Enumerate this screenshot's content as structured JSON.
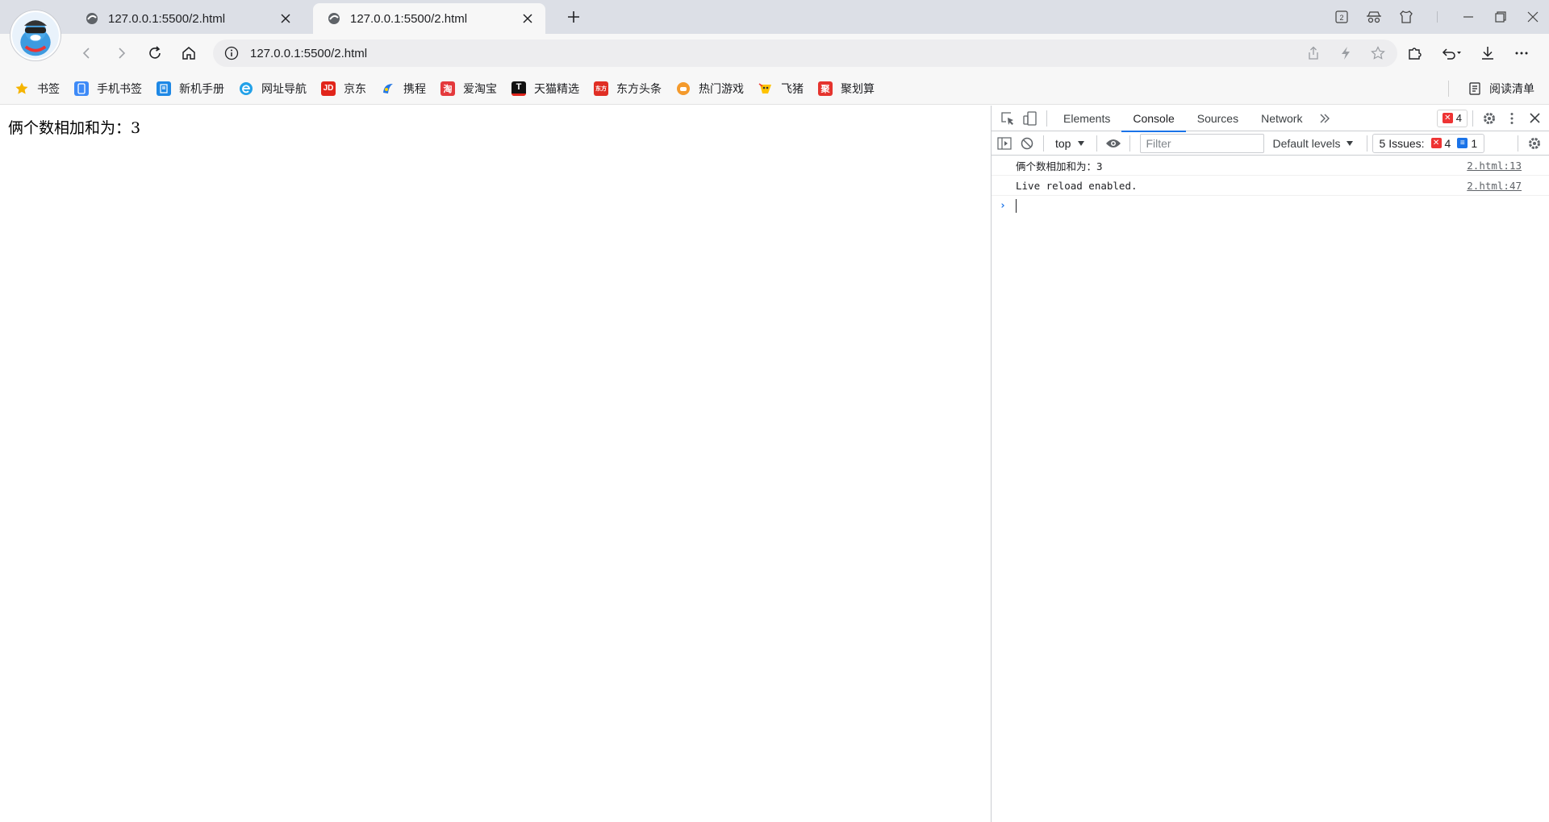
{
  "browser": {
    "tabs": [
      {
        "title": "127.0.0.1:5500/2.html",
        "active": false
      },
      {
        "title": "127.0.0.1:5500/2.html",
        "active": true
      }
    ],
    "address_bar": {
      "url": "127.0.0.1:5500/2.html"
    },
    "window_badge": "2"
  },
  "bookmarks": {
    "items": [
      {
        "label": "书签",
        "icon": "star-icon",
        "color": "#f5b400"
      },
      {
        "label": "手机书签",
        "icon": "phone-icon",
        "color": "#3d8af7"
      },
      {
        "label": "新机手册",
        "icon": "book-icon",
        "color": "#1e88e5"
      },
      {
        "label": "网址导航",
        "icon": "browser-e-icon",
        "color": "#22a1e8"
      },
      {
        "label": "京东",
        "icon": "jd-icon",
        "color": "#e1251b",
        "glyph": "JD"
      },
      {
        "label": "携程",
        "icon": "ctrip-icon",
        "color": "#2577e3"
      },
      {
        "label": "爱淘宝",
        "icon": "taobao-icon",
        "color": "#e4393c",
        "glyph": "淘"
      },
      {
        "label": "天猫精选",
        "icon": "tmall-icon",
        "color": "#111111",
        "glyph": "T"
      },
      {
        "label": "东方头条",
        "icon": "dftt-icon",
        "color": "#e02e24",
        "glyph": "东方"
      },
      {
        "label": "热门游戏",
        "icon": "games-icon",
        "color": "#f49a2c"
      },
      {
        "label": "飞猪",
        "icon": "fliggy-icon",
        "color": "#ffc300"
      },
      {
        "label": "聚划算",
        "icon": "juhuasuan-icon",
        "color": "#e5342e",
        "glyph": "聚"
      }
    ],
    "reading_list": "阅读清单"
  },
  "page": {
    "output": "俩个数相加和为：3"
  },
  "devtools": {
    "tabs": [
      "Elements",
      "Console",
      "Sources",
      "Network"
    ],
    "active_tab": "Console",
    "error_count": "4",
    "context": "top",
    "filter_placeholder": "Filter",
    "levels": "Default levels",
    "issues": {
      "label": "5 Issues:",
      "errors": "4",
      "info": "1"
    },
    "messages": [
      {
        "text": "俩个数相加和为：3",
        "source": "2.html:13"
      },
      {
        "text": "Live reload enabled.",
        "source": "2.html:47"
      }
    ]
  },
  "colors": {
    "accent": "#1a73e8",
    "error": "#e33333"
  }
}
